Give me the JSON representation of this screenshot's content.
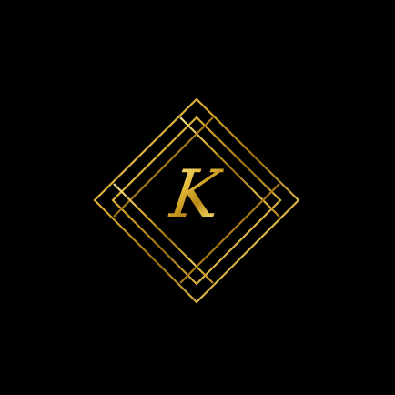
{
  "logo": {
    "monogram": "K",
    "description_icon": "diamond-frame-icon",
    "colors": {
      "background": "#000000",
      "gold_light": "#f7e48a",
      "gold_mid": "#d8a92c",
      "gold_dark": "#9a6d10"
    }
  }
}
